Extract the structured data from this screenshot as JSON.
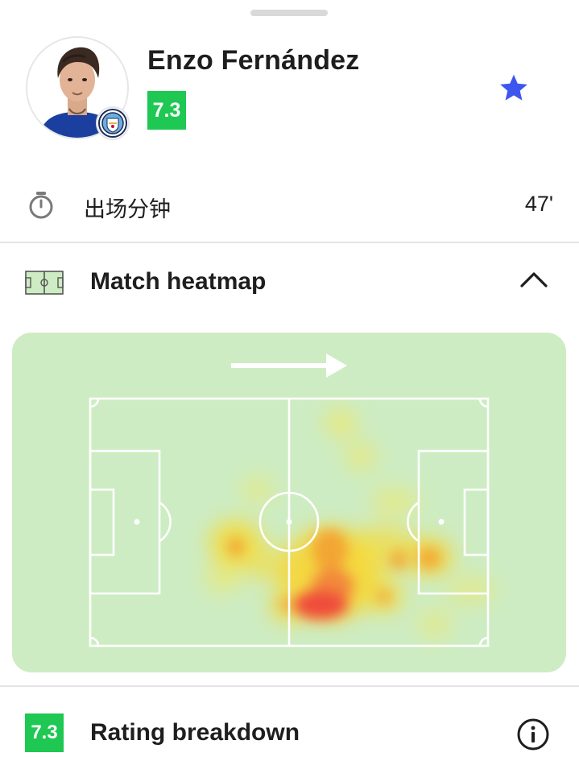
{
  "player": {
    "name": "Enzo Fernández",
    "rating": "7.3",
    "rating_color": "#1ec853",
    "club_badge": "manchester-city-badge",
    "favorite_color": "#3d56f0"
  },
  "stats": {
    "minutes_label": "出场分钟",
    "minutes_value": "47'"
  },
  "heatmap": {
    "title": "Match heatmap",
    "expanded": true,
    "attack_direction": "right",
    "pitch_color": "#cdecc3"
  },
  "rating_breakdown": {
    "rating": "7.3",
    "title": "Rating breakdown"
  },
  "icons": {
    "minutes": "stopwatch-icon",
    "heatmap": "pitch-icon",
    "collapse": "chevron-up-icon",
    "favorite": "star-icon",
    "info": "info-icon"
  }
}
